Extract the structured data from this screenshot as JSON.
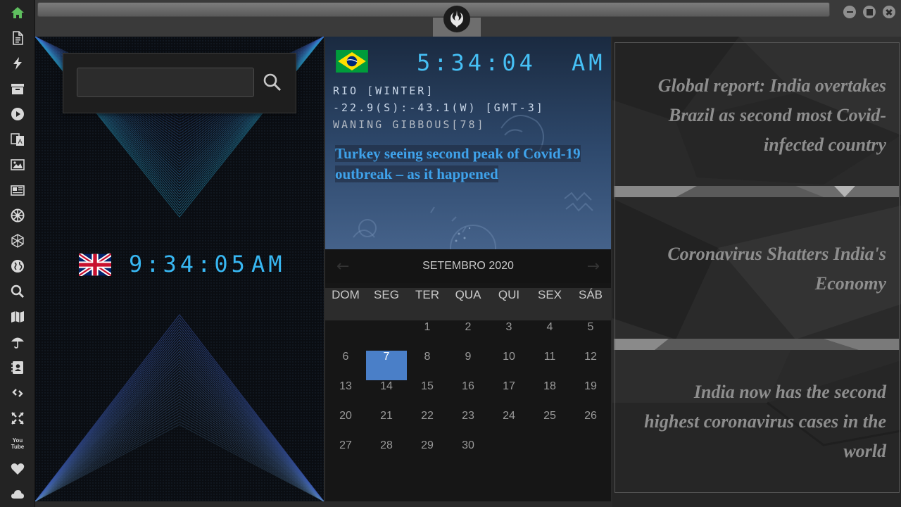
{
  "sidebar": {
    "items": [
      {
        "icon": "home-icon",
        "active": true
      },
      {
        "icon": "document-icon"
      },
      {
        "icon": "lightning-icon"
      },
      {
        "icon": "archive-icon"
      },
      {
        "icon": "play-icon"
      },
      {
        "icon": "translate-icon"
      },
      {
        "icon": "image-icon"
      },
      {
        "icon": "newspaper-icon"
      },
      {
        "icon": "empire-icon"
      },
      {
        "icon": "hexagon-icon"
      },
      {
        "icon": "globe-icon"
      },
      {
        "icon": "search-icon"
      },
      {
        "icon": "map-icon"
      },
      {
        "icon": "umbrella-icon"
      },
      {
        "icon": "contacts-icon"
      },
      {
        "icon": "link-icon"
      },
      {
        "icon": "expand-icon"
      },
      {
        "icon": "youtube-icon"
      },
      {
        "icon": "heart-icon"
      },
      {
        "icon": "cloud-icon"
      }
    ],
    "youtube_text": "You Tube"
  },
  "topbar": {
    "logo": "rebel-alliance-icon",
    "window_buttons": [
      "minimize-icon",
      "maximize-icon",
      "close-icon"
    ]
  },
  "left": {
    "search": {
      "value": "",
      "placeholder": ""
    },
    "clock": {
      "flag": "uk-flag",
      "time": "9:34:05",
      "ampm": "AM"
    }
  },
  "middle": {
    "clock": {
      "flag": "brazil-flag",
      "time": "5:34:04",
      "ampm": "AM"
    },
    "location": "RIO [WINTER]",
    "coords": "-22.9(S):-43.1(W) [GMT-3]",
    "moon": "WANING GIBBOUS[78]",
    "headline": "Turkey seeing second peak of Covid-19 outbreak – as it happened"
  },
  "calendar": {
    "month": "SETEMBRO 2020",
    "prev": "←",
    "next": "→",
    "weekdays": [
      "DOM",
      "SEG",
      "TER",
      "QUA",
      "QUI",
      "SEX",
      "SÁB"
    ],
    "weeks": [
      [
        "",
        "",
        "1",
        "2",
        "3",
        "4",
        "5"
      ],
      [
        "6",
        "7",
        "8",
        "9",
        "10",
        "11",
        "12"
      ],
      [
        "13",
        "14",
        "15",
        "16",
        "17",
        "18",
        "19"
      ],
      [
        "20",
        "21",
        "22",
        "23",
        "24",
        "25",
        "26"
      ],
      [
        "27",
        "28",
        "29",
        "30",
        "",
        "",
        ""
      ]
    ],
    "today": "7"
  },
  "news": [
    "Global report: India overtakes Brazil as second most Covid-infected country",
    "Coronavirus Shatters India's Economy",
    "India now has the second highest coronavirus cases in the world"
  ],
  "colors": {
    "lcd": "#38b7f2",
    "headline": "#3fa2ea",
    "today": "#4a7fc8",
    "active_icon": "#5fbf5f"
  }
}
